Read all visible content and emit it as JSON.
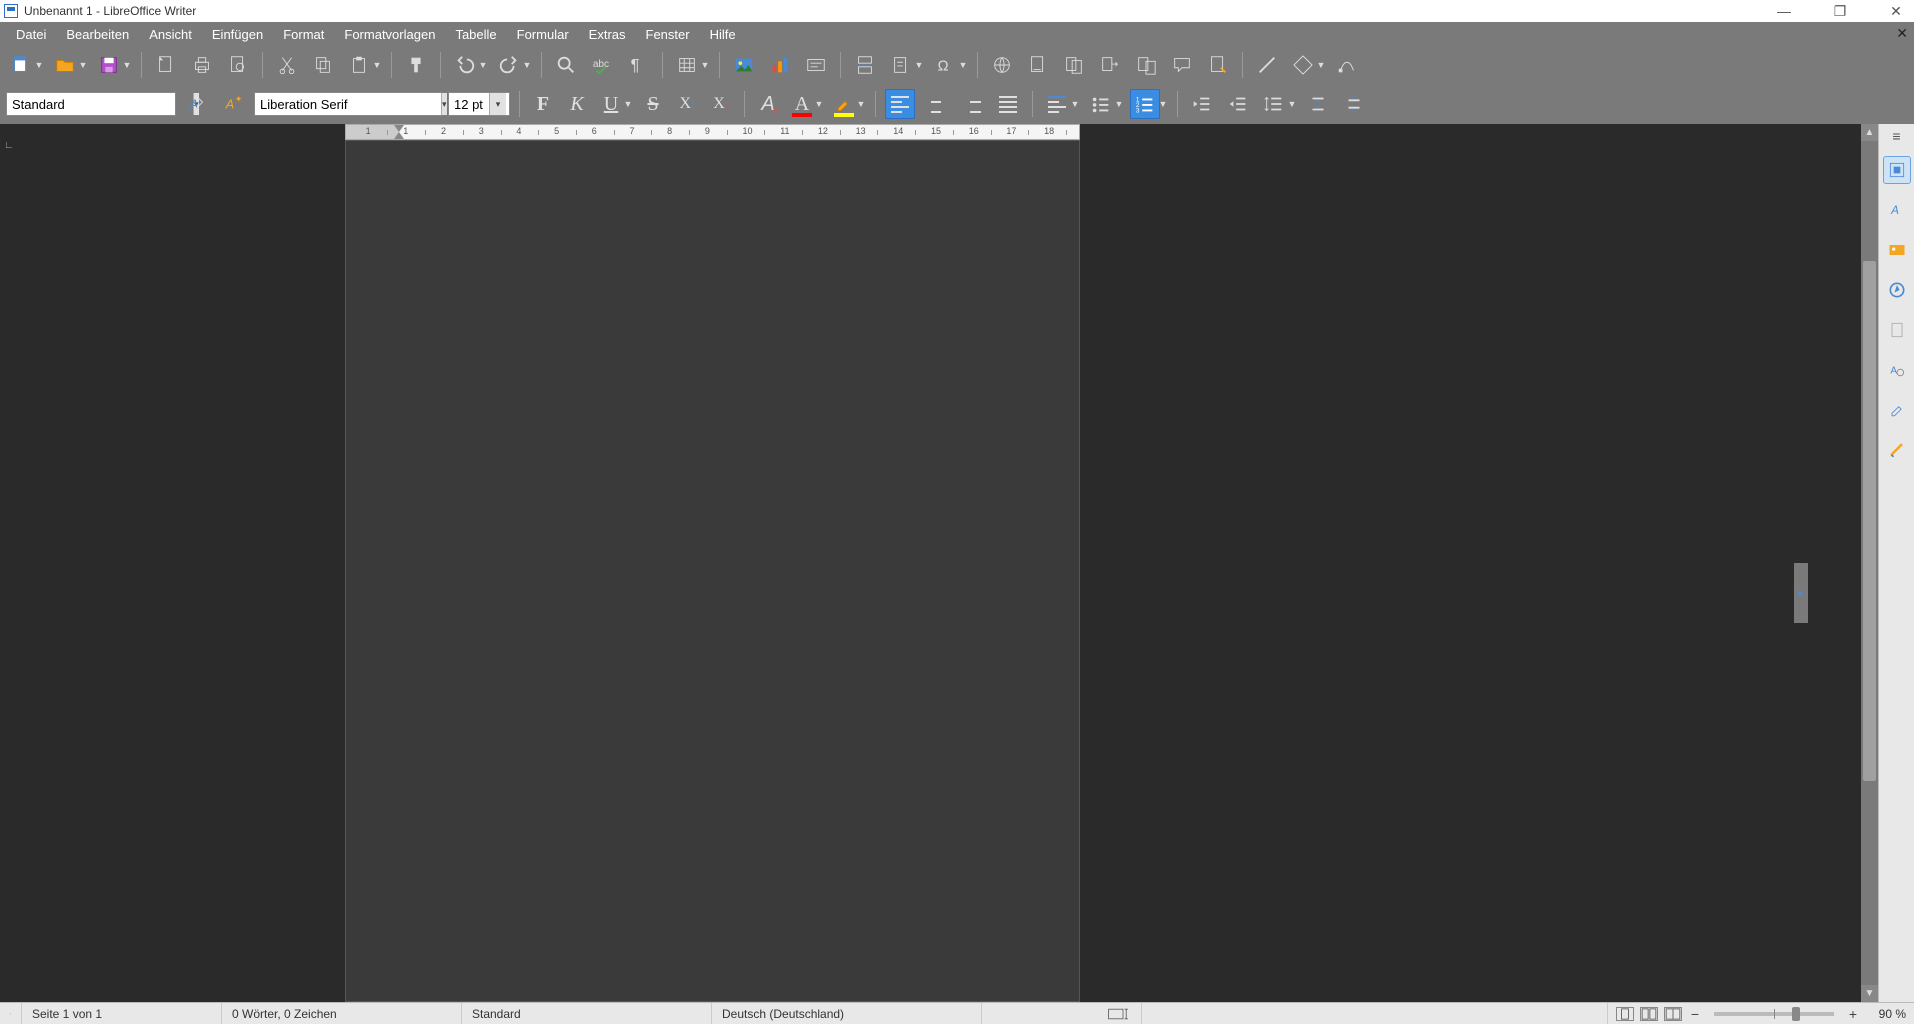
{
  "title": "Unbenannt 1 - LibreOffice Writer",
  "menu": [
    "Datei",
    "Bearbeiten",
    "Ansicht",
    "Einfügen",
    "Format",
    "Formatvorlagen",
    "Tabelle",
    "Formular",
    "Extras",
    "Fenster",
    "Hilfe"
  ],
  "menu_accel": [
    0,
    0,
    0,
    0,
    3,
    6,
    0,
    2,
    1,
    3,
    0
  ],
  "paragraph_style": "Standard",
  "font_name": "Liberation Serif",
  "font_size": "12 pt",
  "ruler_numbers": [
    "1",
    "1",
    "2",
    "3",
    "4",
    "5",
    "6",
    "7",
    "8",
    "9",
    "10",
    "11",
    "12",
    "13",
    "14",
    "15",
    "16",
    "17",
    "18"
  ],
  "status": {
    "page": "Seite 1 von 1",
    "words": "0 Wörter, 0 Zeichen",
    "style": "Standard",
    "language": "Deutsch (Deutschland)",
    "zoom": "90 %"
  },
  "toolbar1_icons": [
    "new",
    "open",
    "save",
    "sep",
    "export-pdf",
    "print",
    "print-preview",
    "sep",
    "cut",
    "copy",
    "paste",
    "sep",
    "clone-format",
    "sep",
    "undo",
    "redo",
    "sep",
    "find",
    "spellcheck",
    "formatting-marks",
    "sep",
    "table",
    "sep",
    "image",
    "chart",
    "text-box",
    "sep",
    "page-break",
    "section",
    "sep",
    "special-char",
    "sep",
    "hyperlink",
    "footnote",
    "bookmark",
    "cross-ref",
    "track-changes",
    "comment",
    "show-draw",
    "sep",
    "line",
    "basic-shape",
    "draw"
  ],
  "toolbar2_icons": [
    "style-combo",
    "update-style",
    "new-style",
    "font-combo",
    "size-combo",
    "sep",
    "bold",
    "italic",
    "underline",
    "sep",
    "strike",
    "superscript",
    "subscript",
    "sep",
    "clear-format",
    "font-color",
    "highlight",
    "char-highlight",
    "sep",
    "align-left",
    "align-center",
    "align-right",
    "align-justify",
    "sep",
    "indent-list",
    "sep",
    "bullet-list",
    "sep",
    "number-list",
    "sep",
    "outdent",
    "indent",
    "sep",
    "line-spacing",
    "para-spacing"
  ],
  "sidebar_icons": [
    "properties",
    "styles",
    "gallery",
    "navigator",
    "page",
    "style-inspector",
    "clone",
    "manage"
  ]
}
